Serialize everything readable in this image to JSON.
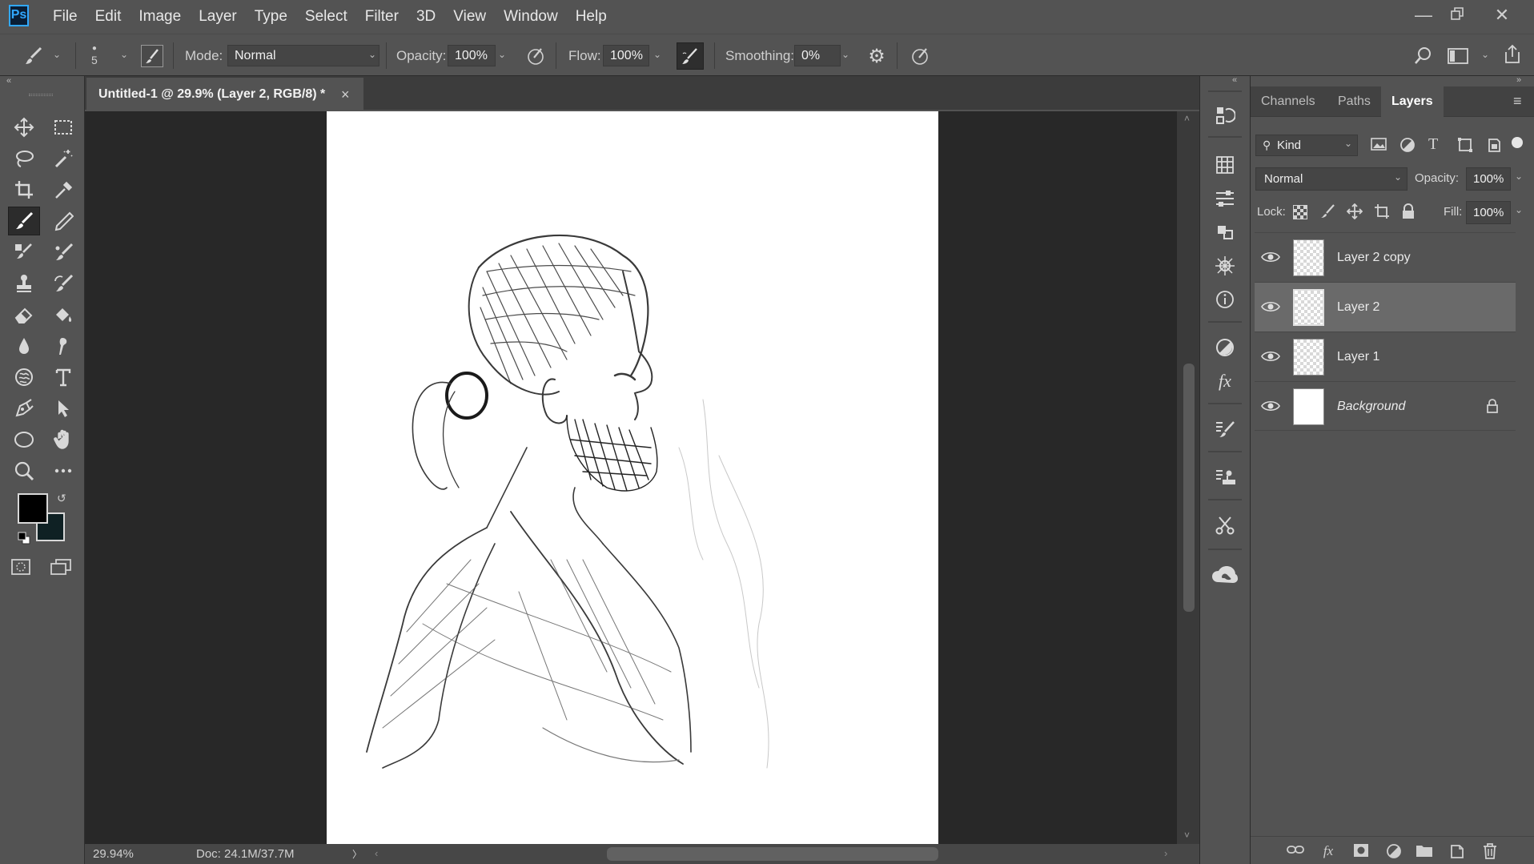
{
  "app": {
    "logo": "Ps"
  },
  "menu": [
    "File",
    "Edit",
    "Image",
    "Layer",
    "Type",
    "Select",
    "Filter",
    "3D",
    "View",
    "Window",
    "Help"
  ],
  "options": {
    "brush_size": "5",
    "mode_label": "Mode:",
    "mode_value": "Normal",
    "opacity_label": "Opacity:",
    "opacity_value": "100%",
    "flow_label": "Flow:",
    "flow_value": "100%",
    "smoothing_label": "Smoothing:",
    "smoothing_value": "0%"
  },
  "document": {
    "tab_title": "Untitled-1 @ 29.9% (Layer 2, RGB/8) *",
    "close": "×"
  },
  "status": {
    "zoom": "29.94%",
    "doc": "Doc: 24.1M/37.7M",
    "more": "〉"
  },
  "colors": {
    "foreground": "#000000",
    "background": "#0f2124",
    "accent": "#31a8ff"
  },
  "panel": {
    "tabs": [
      "Channels",
      "Paths",
      "Layers"
    ],
    "active_tab": "Layers",
    "filter_kind": "Kind",
    "blend_mode": "Normal",
    "opacity_label": "Opacity:",
    "opacity_value": "100%",
    "lock_label": "Lock:",
    "fill_label": "Fill:",
    "fill_value": "100%",
    "layers": [
      {
        "name": "Layer 2 copy",
        "visible": true,
        "selected": false
      },
      {
        "name": "Layer 2",
        "visible": true,
        "selected": true
      },
      {
        "name": "Layer 1",
        "visible": true,
        "selected": false
      },
      {
        "name": "Background",
        "visible": true,
        "selected": false,
        "locked": true
      }
    ]
  },
  "tools": [
    "move-tool",
    "marquee-tool",
    "lasso-tool",
    "magic-wand-tool",
    "crop-tool",
    "eyedropper-tool",
    "brush-tool",
    "pencil-tool",
    "healing-brush-tool",
    "mixer-brush-tool",
    "clone-stamp-tool",
    "history-brush-tool",
    "eraser-tool",
    "paint-bucket-tool",
    "blur-tool",
    "smudge-tool",
    "sponge-tool",
    "type-tool",
    "pen-tool",
    "path-selection-tool",
    "ellipse-tool",
    "hand-tool",
    "zoom-tool",
    "more-tools"
  ]
}
